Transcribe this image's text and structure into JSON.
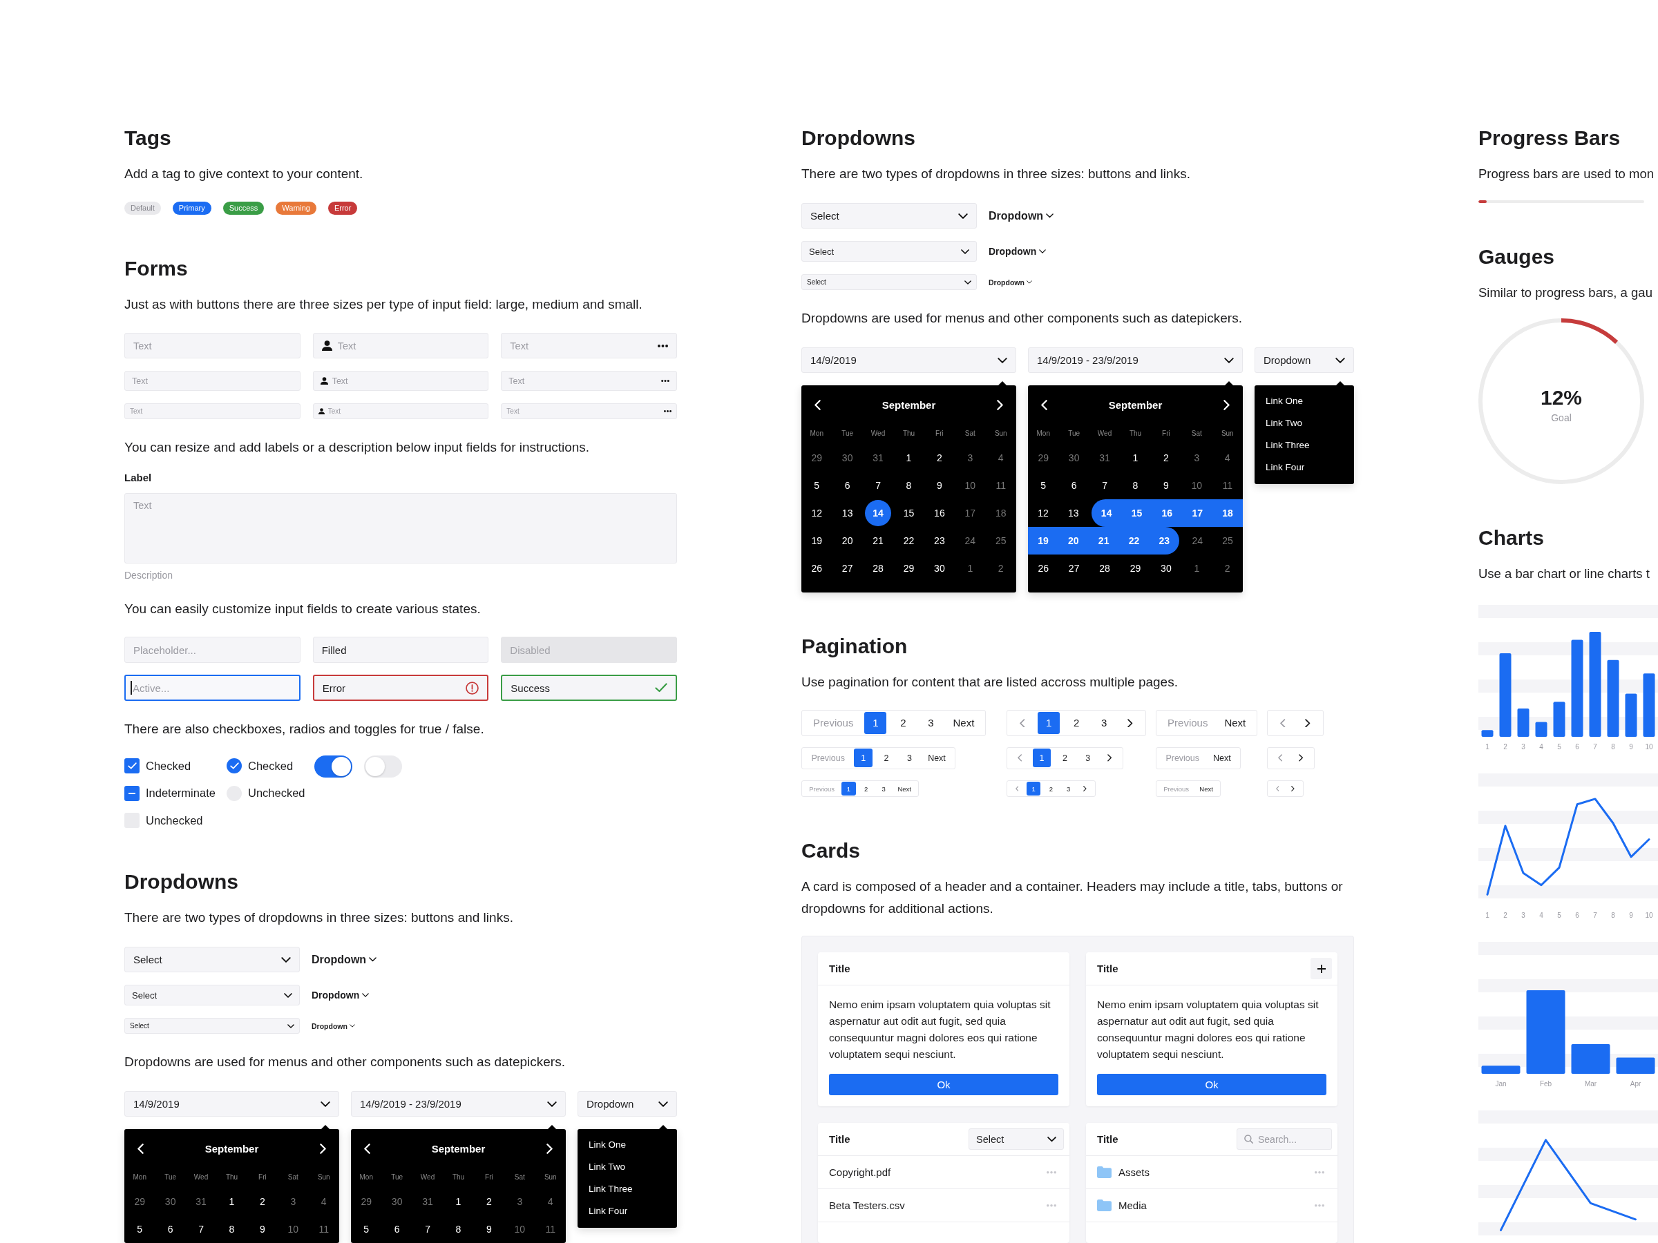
{
  "columns": [
    {
      "sections": [
        {
          "kind": "tags",
          "title": "Tags",
          "description": "Add a tag to give context to your content.",
          "tags": [
            {
              "label": "Default",
              "color": "#e9e9ec"
            },
            {
              "label": "Primary",
              "color": "#1b6cf2"
            },
            {
              "label": "Success",
              "color": "#3a9d46"
            },
            {
              "label": "Warning",
              "color": "#e8793a"
            },
            {
              "label": "Error",
              "color": "#c73a3a"
            }
          ]
        },
        {
          "kind": "forms",
          "title": "Forms",
          "description": "Just as with buttons there are three sizes per type of input field: large, medium and small.",
          "input_rows": [
            {
              "kind": "large",
              "fields": [
                {
                  "kind": "plain",
                  "placeholder": "Text"
                },
                {
                  "kind": "user",
                  "placeholder": "Text"
                },
                {
                  "kind": "more",
                  "placeholder": "Text"
                }
              ]
            },
            {
              "kind": "medium",
              "fields": [
                {
                  "kind": "plain",
                  "placeholder": "Text"
                },
                {
                  "kind": "user",
                  "placeholder": "Text"
                },
                {
                  "kind": "more",
                  "placeholder": "Text"
                }
              ]
            },
            {
              "kind": "small",
              "fields": [
                {
                  "kind": "plain",
                  "placeholder": "Text"
                },
                {
                  "kind": "user",
                  "placeholder": "Text"
                },
                {
                  "kind": "more",
                  "placeholder": "Text"
                }
              ]
            }
          ],
          "label_text": "You can resize and add labels or a description below input fields for instructions.",
          "labeled_field": {
            "label": "Label",
            "placeholder": "Text",
            "description": "Description"
          },
          "states_text": "You can easily customize input fields to create various states.",
          "state_fields": [
            {
              "kind": "plain",
              "disabled": false,
              "placeholder": "Placeholder..."
            },
            {
              "kind": "plain",
              "disabled": false,
              "value": "Filled"
            },
            {
              "kind": "plain",
              "disabled": true,
              "placeholder": "Disabled"
            },
            {
              "kind": "active",
              "disabled": false,
              "placeholder": "Active..."
            },
            {
              "kind": "error",
              "disabled": false,
              "value": "Error"
            },
            {
              "kind": "success",
              "disabled": false,
              "value": "Success"
            }
          ],
          "choices_text": "There are also checkboxes, radios and toggles for true / false.",
          "checkboxes": [
            {
              "kind": "tick",
              "label": "Checked",
              "checked": true
            },
            {
              "kind": "dash",
              "label": "Indeterminate",
              "checked": true
            },
            {
              "kind": "tick",
              "label": "Unchecked",
              "checked": false
            }
          ],
          "radios": [
            {
              "label": "Checked",
              "selected": true
            },
            {
              "label": "Unchecked",
              "selected": false
            }
          ],
          "toggles": [
            {
              "on": true
            },
            {
              "on": false
            }
          ]
        },
        {
          "kind": "dropdowns",
          "title": "Dropdowns",
          "description": "There are two types of dropdowns in three sizes: buttons and links.",
          "sizes": [
            {
              "kind": "large",
              "select": "Select",
              "link": "Dropdown"
            },
            {
              "kind": "medium",
              "select": "Select",
              "link": "Dropdown"
            },
            {
              "kind": "small",
              "select": "Select",
              "link": "Dropdown"
            }
          ],
          "pickers_text": "Dropdowns are used for menus and other components such as datepickers.",
          "pickers": [
            {
              "kind": "calendar",
              "value": "14/9/2019",
              "calendar": {
                "month": "September",
                "weekdays": [
                  "Mon",
                  "Tue",
                  "Wed",
                  "Thu",
                  "Fri",
                  "Sat",
                  "Sun"
                ],
                "weeks": [
                  [
                    {
                      "day": "29",
                      "muted": true,
                      "selected": false
                    },
                    {
                      "day": "30",
                      "muted": true,
                      "selected": false
                    },
                    {
                      "day": "31",
                      "muted": true,
                      "selected": false
                    },
                    {
                      "day": "1",
                      "muted": false,
                      "selected": false
                    },
                    {
                      "day": "2",
                      "muted": false,
                      "selected": false
                    },
                    {
                      "day": "3",
                      "muted": true,
                      "selected": false
                    },
                    {
                      "day": "4",
                      "muted": true,
                      "selected": false
                    }
                  ],
                  [
                    {
                      "day": "5",
                      "muted": false,
                      "selected": false
                    },
                    {
                      "day": "6",
                      "muted": false,
                      "selected": false
                    },
                    {
                      "day": "7",
                      "muted": false,
                      "selected": false
                    },
                    {
                      "day": "8",
                      "muted": false,
                      "selected": false
                    },
                    {
                      "day": "9",
                      "muted": false,
                      "selected": false
                    },
                    {
                      "day": "10",
                      "muted": true,
                      "selected": false
                    },
                    {
                      "day": "11",
                      "muted": true,
                      "selected": false
                    }
                  ]
                ]
              }
            },
            {
              "kind": "calendar",
              "value": "14/9/2019 - 23/9/2019",
              "calendar": {
                "month": "September",
                "weekdays": [
                  "Mon",
                  "Tue",
                  "Wed",
                  "Thu",
                  "Fri",
                  "Sat",
                  "Sun"
                ],
                "weeks": [
                  [
                    {
                      "day": "29",
                      "muted": true,
                      "selected": false
                    },
                    {
                      "day": "30",
                      "muted": true,
                      "selected": false
                    },
                    {
                      "day": "31",
                      "muted": true,
                      "selected": false
                    },
                    {
                      "day": "1",
                      "muted": false,
                      "selected": false
                    },
                    {
                      "day": "2",
                      "muted": false,
                      "selected": false
                    },
                    {
                      "day": "3",
                      "muted": true,
                      "selected": false
                    },
                    {
                      "day": "4",
                      "muted": true,
                      "selected": false
                    }
                  ],
                  [
                    {
                      "day": "5",
                      "muted": false,
                      "selected": false
                    },
                    {
                      "day": "6",
                      "muted": false,
                      "selected": false
                    },
                    {
                      "day": "7",
                      "muted": false,
                      "selected": false
                    },
                    {
                      "day": "8",
                      "muted": false,
                      "selected": false
                    },
                    {
                      "day": "9",
                      "muted": false,
                      "selected": false
                    },
                    {
                      "day": "10",
                      "muted": true,
                      "selected": false
                    },
                    {
                      "day": "11",
                      "muted": true,
                      "selected": false
                    }
                  ]
                ]
              }
            },
            {
              "kind": "menu",
              "value": "Dropdown",
              "links": [
                "Link One",
                "Link Two",
                "Link Three",
                "Link Four"
              ]
            }
          ]
        }
      ]
    },
    {
      "sections": [
        {
          "kind": "dropdowns",
          "title": "Dropdowns",
          "description": "There are two types of dropdowns in three sizes: buttons and links.",
          "sizes": [
            {
              "kind": "large",
              "select": "Select",
              "link": "Dropdown"
            },
            {
              "kind": "medium",
              "select": "Select",
              "link": "Dropdown"
            },
            {
              "kind": "small",
              "select": "Select",
              "link": "Dropdown"
            }
          ],
          "pickers_text": "Dropdowns are used for menus and other components such as datepickers.",
          "pickers": [
            {
              "kind": "calendar",
              "value": "14/9/2019",
              "calendar": {
                "month": "September",
                "weekdays": [
                  "Mon",
                  "Tue",
                  "Wed",
                  "Thu",
                  "Fri",
                  "Sat",
                  "Sun"
                ],
                "weeks": [
                  [
                    {
                      "day": "29",
                      "muted": true,
                      "selected": false
                    },
                    {
                      "day": "30",
                      "muted": true,
                      "selected": false
                    },
                    {
                      "day": "31",
                      "muted": true,
                      "selected": false
                    },
                    {
                      "day": "1",
                      "muted": false,
                      "selected": false
                    },
                    {
                      "day": "2",
                      "muted": false,
                      "selected": false
                    },
                    {
                      "day": "3",
                      "muted": true,
                      "selected": false
                    },
                    {
                      "day": "4",
                      "muted": true,
                      "selected": false
                    }
                  ],
                  [
                    {
                      "day": "5",
                      "muted": false,
                      "selected": false
                    },
                    {
                      "day": "6",
                      "muted": false,
                      "selected": false
                    },
                    {
                      "day": "7",
                      "muted": false,
                      "selected": false
                    },
                    {
                      "day": "8",
                      "muted": false,
                      "selected": false
                    },
                    {
                      "day": "9",
                      "muted": false,
                      "selected": false
                    },
                    {
                      "day": "10",
                      "muted": true,
                      "selected": false
                    },
                    {
                      "day": "11",
                      "muted": true,
                      "selected": false
                    }
                  ],
                  [
                    {
                      "day": "12",
                      "muted": false,
                      "selected": false
                    },
                    {
                      "day": "13",
                      "muted": false,
                      "selected": false
                    },
                    {
                      "day": "14",
                      "muted": false,
                      "selected": true
                    },
                    {
                      "day": "15",
                      "muted": false,
                      "selected": false
                    },
                    {
                      "day": "16",
                      "muted": false,
                      "selected": false
                    },
                    {
                      "day": "17",
                      "muted": true,
                      "selected": false
                    },
                    {
                      "day": "18",
                      "muted": true,
                      "selected": false
                    }
                  ],
                  [
                    {
                      "day": "19",
                      "muted": false,
                      "selected": false
                    },
                    {
                      "day": "20",
                      "muted": false,
                      "selected": false
                    },
                    {
                      "day": "21",
                      "muted": false,
                      "selected": false
                    },
                    {
                      "day": "22",
                      "muted": false,
                      "selected": false
                    },
                    {
                      "day": "23",
                      "muted": false,
                      "selected": false
                    },
                    {
                      "day": "24",
                      "muted": true,
                      "selected": false
                    },
                    {
                      "day": "25",
                      "muted": true,
                      "selected": false
                    }
                  ],
                  [
                    {
                      "day": "26",
                      "muted": false,
                      "selected": false
                    },
                    {
                      "day": "27",
                      "muted": false,
                      "selected": false
                    },
                    {
                      "day": "28",
                      "muted": false,
                      "selected": false
                    },
                    {
                      "day": "29",
                      "muted": false,
                      "selected": false
                    },
                    {
                      "day": "30",
                      "muted": false,
                      "selected": false
                    },
                    {
                      "day": "1",
                      "muted": true,
                      "selected": false
                    },
                    {
                      "day": "2",
                      "muted": true,
                      "selected": false
                    }
                  ]
                ]
              }
            },
            {
              "kind": "calendar",
              "value": "14/9/2019 - 23/9/2019",
              "calendar": {
                "month": "September",
                "weekdays": [
                  "Mon",
                  "Tue",
                  "Wed",
                  "Thu",
                  "Fri",
                  "Sat",
                  "Sun"
                ],
                "weeks": [
                  [
                    {
                      "day": "29",
                      "muted": true,
                      "selected": false
                    },
                    {
                      "day": "30",
                      "muted": true,
                      "selected": false
                    },
                    {
                      "day": "31",
                      "muted": true,
                      "selected": false
                    },
                    {
                      "day": "1",
                      "muted": false,
                      "selected": false
                    },
                    {
                      "day": "2",
                      "muted": false,
                      "selected": false
                    },
                    {
                      "day": "3",
                      "muted": true,
                      "selected": false
                    },
                    {
                      "day": "4",
                      "muted": true,
                      "selected": false
                    }
                  ],
                  [
                    {
                      "day": "5",
                      "muted": false,
                      "selected": false
                    },
                    {
                      "day": "6",
                      "muted": false,
                      "selected": false
                    },
                    {
                      "day": "7",
                      "muted": false,
                      "selected": false
                    },
                    {
                      "day": "8",
                      "muted": false,
                      "selected": false
                    },
                    {
                      "day": "9",
                      "muted": false,
                      "selected": false
                    },
                    {
                      "day": "10",
                      "muted": true,
                      "selected": false
                    },
                    {
                      "day": "11",
                      "muted": true,
                      "selected": false
                    }
                  ],
                  [
                    {
                      "day": "12",
                      "muted": false,
                      "selected": false
                    },
                    {
                      "day": "13",
                      "muted": false,
                      "selected": false
                    },
                    {
                      "day": "14",
                      "muted": false,
                      "selected": true
                    },
                    {
                      "day": "15",
                      "muted": false,
                      "selected": true
                    },
                    {
                      "day": "16",
                      "muted": false,
                      "selected": true
                    },
                    {
                      "day": "17",
                      "muted": false,
                      "selected": true
                    },
                    {
                      "day": "18",
                      "muted": false,
                      "selected": true
                    }
                  ],
                  [
                    {
                      "day": "19",
                      "muted": false,
                      "selected": true
                    },
                    {
                      "day": "20",
                      "muted": false,
                      "selected": true
                    },
                    {
                      "day": "21",
                      "muted": false,
                      "selected": true
                    },
                    {
                      "day": "22",
                      "muted": false,
                      "selected": true
                    },
                    {
                      "day": "23",
                      "muted": false,
                      "selected": true
                    },
                    {
                      "day": "24",
                      "muted": true,
                      "selected": false
                    },
                    {
                      "day": "25",
                      "muted": true,
                      "selected": false
                    }
                  ],
                  [
                    {
                      "day": "26",
                      "muted": false,
                      "selected": false
                    },
                    {
                      "day": "27",
                      "muted": false,
                      "selected": false
                    },
                    {
                      "day": "28",
                      "muted": false,
                      "selected": false
                    },
                    {
                      "day": "29",
                      "muted": false,
                      "selected": false
                    },
                    {
                      "day": "30",
                      "muted": false,
                      "selected": false
                    },
                    {
                      "day": "1",
                      "muted": true,
                      "selected": false
                    },
                    {
                      "day": "2",
                      "muted": true,
                      "selected": false
                    }
                  ]
                ]
              }
            },
            {
              "kind": "menu",
              "value": "Dropdown",
              "links": [
                "Link One",
                "Link Two",
                "Link Three",
                "Link Four"
              ]
            }
          ]
        },
        {
          "kind": "pagination",
          "title": "Pagination",
          "description": "Use pagination for content that are listed accross multiple pages.",
          "rows": [
            {
              "kind": "large",
              "groups": [
                {
                  "kind": "text",
                  "previous": {
                    "label": "Previous",
                    "disabled": true
                  },
                  "pages": [
                    {
                      "label": "1",
                      "selected": true
                    },
                    {
                      "label": "2",
                      "selected": false
                    },
                    {
                      "label": "3",
                      "selected": false
                    }
                  ],
                  "next": {
                    "label": "Next",
                    "disabled": false
                  }
                },
                {
                  "kind": "icon",
                  "previous": {
                    "disabled": true
                  },
                  "pages": [
                    {
                      "label": "1",
                      "selected": true
                    },
                    {
                      "label": "2",
                      "selected": false
                    },
                    {
                      "label": "3",
                      "selected": false
                    }
                  ],
                  "next": {
                    "disabled": false
                  }
                },
                {
                  "kind": "text",
                  "previous": {
                    "label": "Previous",
                    "disabled": true
                  },
                  "next": {
                    "label": "Next",
                    "disabled": false
                  }
                },
                {
                  "kind": "icon",
                  "previous": {
                    "disabled": true
                  },
                  "next": {
                    "disabled": false
                  }
                }
              ]
            },
            {
              "kind": "medium",
              "groups": [
                {
                  "kind": "text",
                  "previous": {
                    "label": "Previous",
                    "disabled": true
                  },
                  "pages": [
                    {
                      "label": "1",
                      "selected": true
                    },
                    {
                      "label": "2",
                      "selected": false
                    },
                    {
                      "label": "3",
                      "selected": false
                    }
                  ],
                  "next": {
                    "label": "Next",
                    "disabled": false
                  }
                },
                {
                  "kind": "icon",
                  "previous": {
                    "disabled": true
                  },
                  "pages": [
                    {
                      "label": "1",
                      "selected": true
                    },
                    {
                      "label": "2",
                      "selected": false
                    },
                    {
                      "label": "3",
                      "selected": false
                    }
                  ],
                  "next": {
                    "disabled": false
                  }
                },
                {
                  "kind": "text",
                  "previous": {
                    "label": "Previous",
                    "disabled": true
                  },
                  "next": {
                    "label": "Next",
                    "disabled": false
                  }
                },
                {
                  "kind": "icon",
                  "previous": {
                    "disabled": true
                  },
                  "next": {
                    "disabled": false
                  }
                }
              ]
            },
            {
              "kind": "small",
              "groups": [
                {
                  "kind": "text",
                  "previous": {
                    "label": "Previous",
                    "disabled": true
                  },
                  "pages": [
                    {
                      "label": "1",
                      "selected": true
                    },
                    {
                      "label": "2",
                      "selected": false
                    },
                    {
                      "label": "3",
                      "selected": false
                    }
                  ],
                  "next": {
                    "label": "Next",
                    "disabled": false
                  }
                },
                {
                  "kind": "icon",
                  "previous": {
                    "disabled": true
                  },
                  "pages": [
                    {
                      "label": "1",
                      "selected": true
                    },
                    {
                      "label": "2",
                      "selected": false
                    },
                    {
                      "label": "3",
                      "selected": false
                    }
                  ],
                  "next": {
                    "disabled": false
                  }
                },
                {
                  "kind": "text",
                  "previous": {
                    "label": "Previous",
                    "disabled": true
                  },
                  "next": {
                    "label": "Next",
                    "disabled": false
                  }
                },
                {
                  "kind": "icon",
                  "previous": {
                    "disabled": true
                  },
                  "next": {
                    "disabled": false
                  }
                }
              ]
            }
          ]
        },
        {
          "kind": "cards",
          "title": "Cards",
          "description": "A card is composed of a header and a container. Headers may include a title, tabs, buttons or dropdowns for additional actions.",
          "cards": [
            {
              "kind": "text",
              "title": "Title",
              "body": "Nemo enim ipsam voluptatem quia voluptas sit aspernatur aut odit aut fugit, sed quia consequuntur magni dolores eos qui ratione voluptatem sequi nesciunt.",
              "button": "Ok"
            },
            {
              "kind": "text",
              "title": "Title",
              "header_button": {
                "kind": "add"
              },
              "body": "Nemo enim ipsam voluptatem quia voluptas sit aspernatur aut odit aut fugit, sed quia consequuntur magni dolores eos qui ratione voluptatem sequi nesciunt.",
              "button": "Ok"
            },
            {
              "kind": "list",
              "title": "Title",
              "select": "Select",
              "rows": [
                {
                  "kind": "plain",
                  "name": "Copyright.pdf"
                },
                {
                  "kind": "plain",
                  "name": "Beta Testers.csv"
                }
              ]
            },
            {
              "kind": "list",
              "title": "Title",
              "search": {
                "placeholder": "Search..."
              },
              "rows": [
                {
                  "kind": "folder",
                  "name": "Assets"
                },
                {
                  "kind": "folder",
                  "name": "Media"
                }
              ]
            }
          ]
        }
      ]
    },
    {
      "sections": [
        {
          "kind": "progress",
          "title": "Progress Bars",
          "description": "Progress bars are used to mon",
          "bars": [
            {
              "level": 0.05
            }
          ]
        },
        {
          "kind": "gauge",
          "title": "Gauges",
          "description": "Similar to progress bars, a gau",
          "gauges": [
            {
              "level": 0.12,
              "value": "12%",
              "label": "Goal"
            }
          ]
        },
        {
          "kind": "charts",
          "title": "Charts",
          "description": "Use a bar chart or line charts t",
          "charts": [
            {
              "kind": "bar",
              "x_labels": [
                "1",
                "2",
                "3",
                "4",
                "5",
                "6",
                "7",
                "8",
                "9",
                "10"
              ]
            },
            {
              "kind": "line",
              "x_labels": [
                "1",
                "2",
                "3",
                "4",
                "5",
                "6",
                "7",
                "8",
                "9",
                "10"
              ]
            },
            {
              "kind": "bar",
              "x_labels": [
                "Jan",
                "Feb",
                "Mar",
                "Apr"
              ]
            },
            {
              "kind": "line"
            }
          ]
        }
      ]
    }
  ]
}
